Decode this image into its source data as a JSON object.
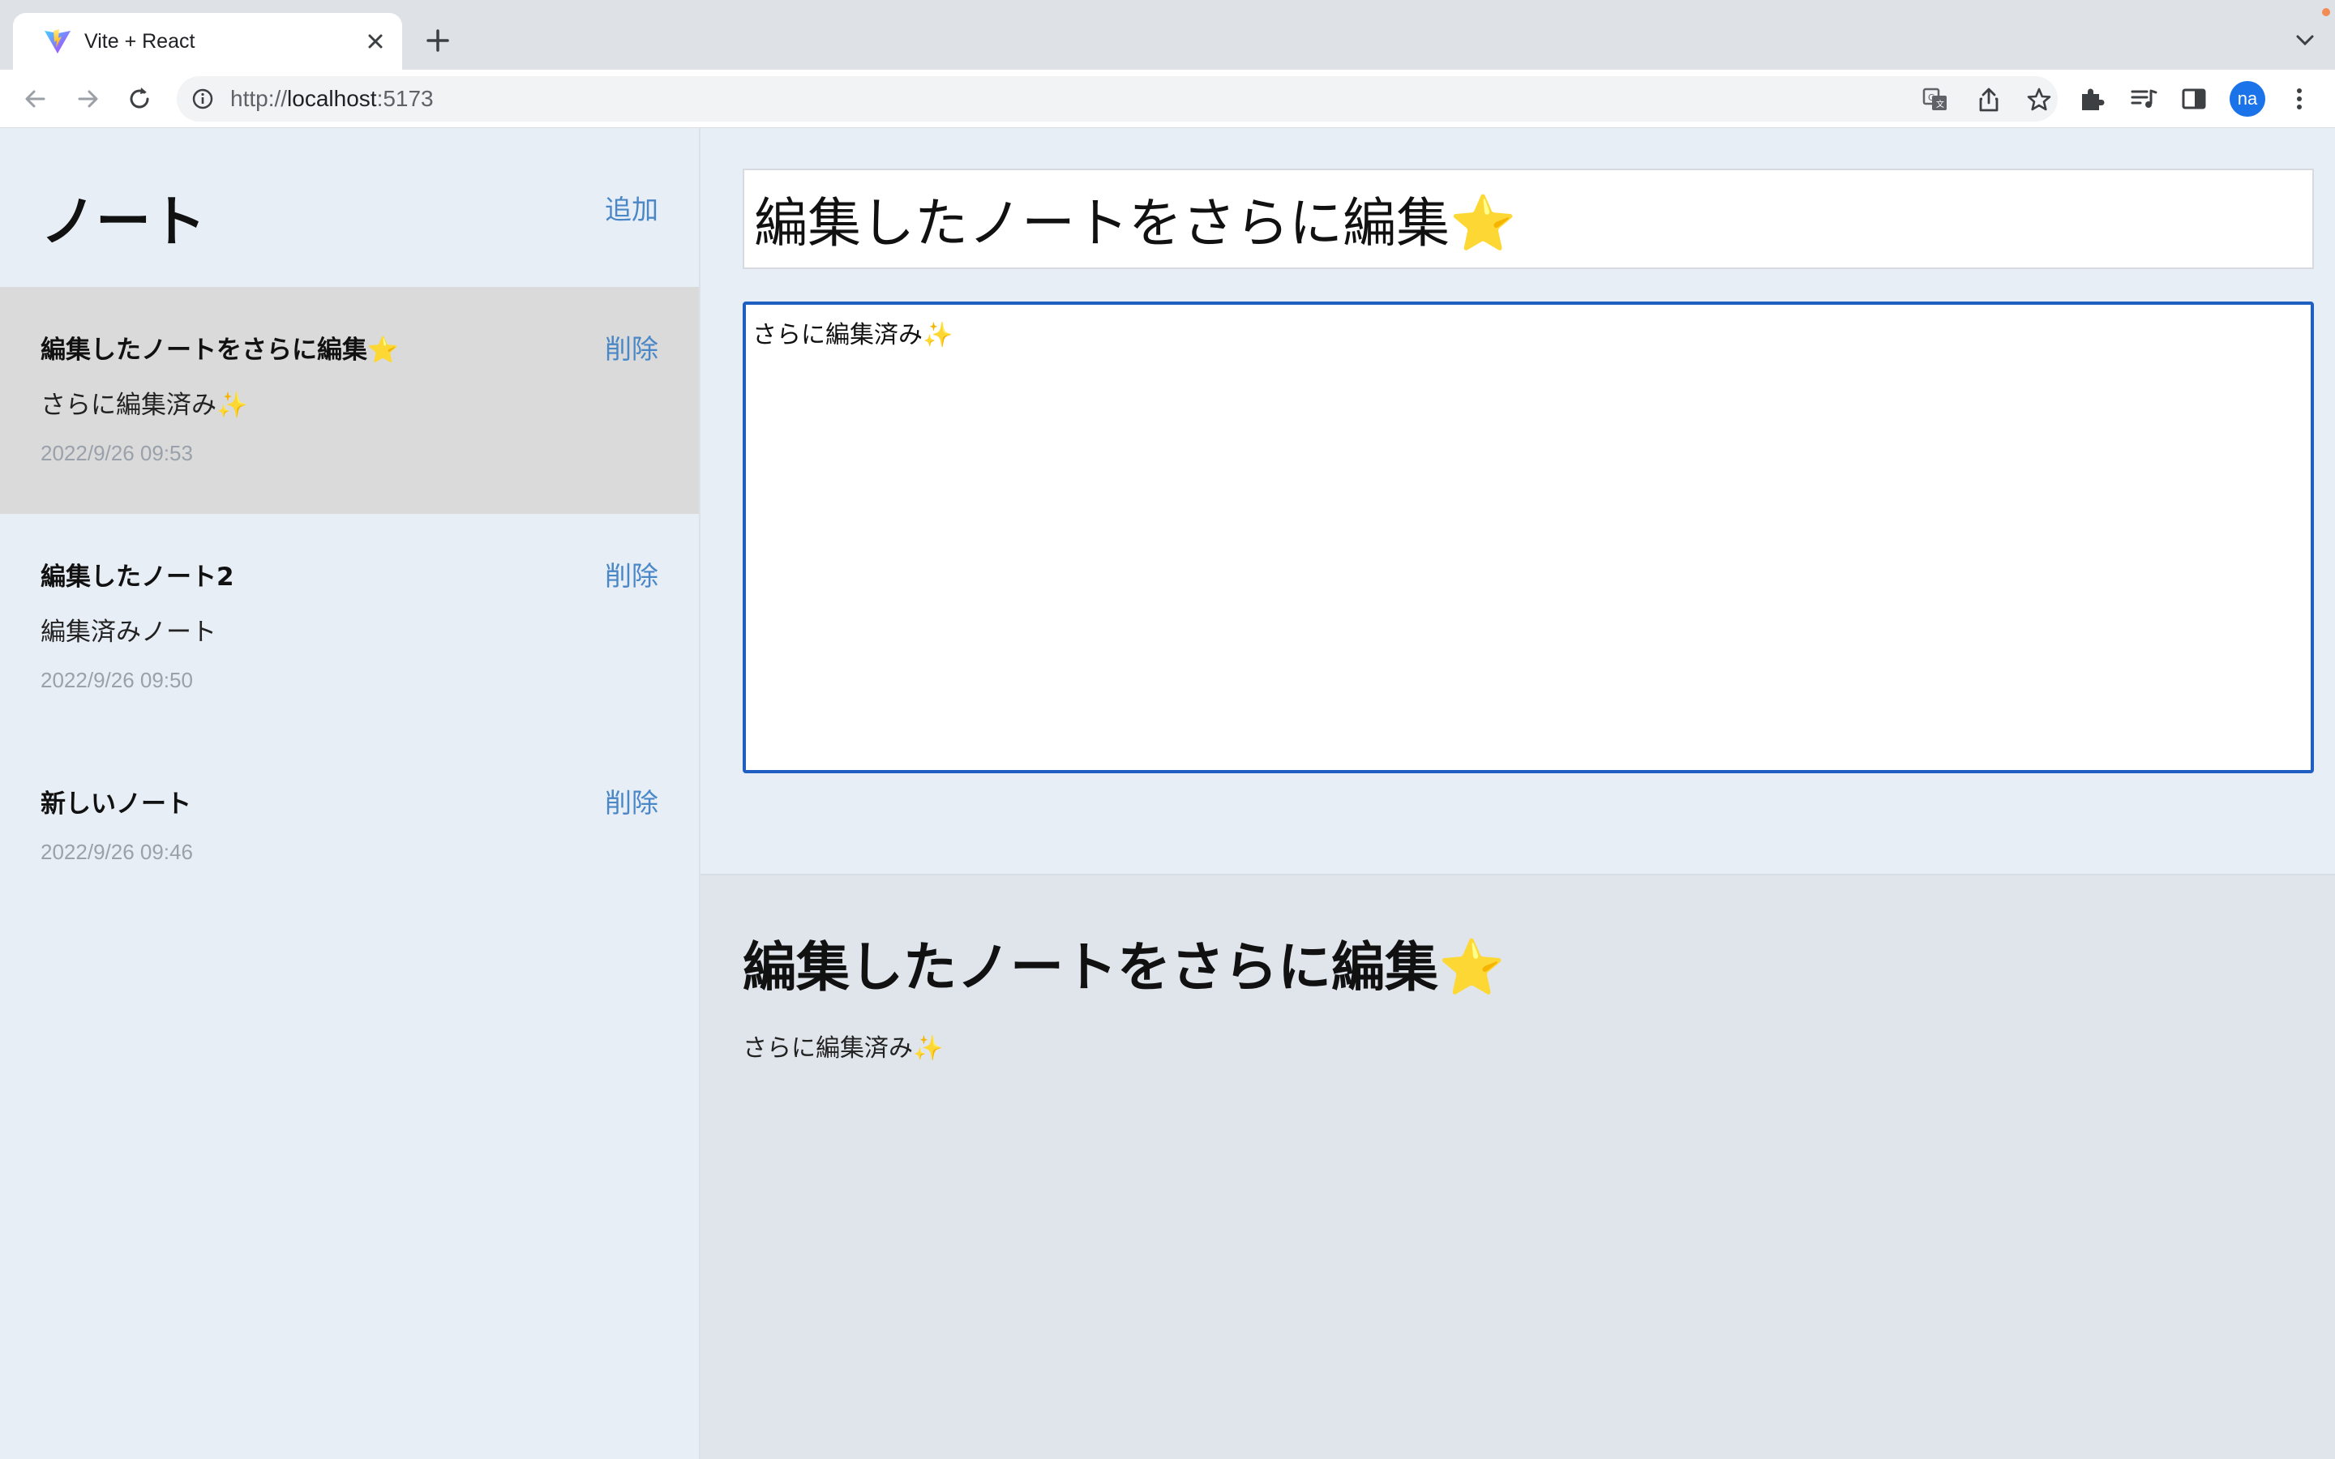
{
  "browser": {
    "tab_title": "Vite + React",
    "url_scheme": "http://",
    "url_host": "localhost",
    "url_port": ":5173",
    "profile_initials": "na"
  },
  "sidebar": {
    "title": "ノート",
    "add_label": "追加",
    "notes": [
      {
        "title": "編集したノートをさらに編集⭐",
        "body": "さらに編集済み✨",
        "date": "2022/9/26 09:53",
        "delete_label": "削除",
        "active": true
      },
      {
        "title": "編集したノート2",
        "body": "編集済みノート",
        "date": "2022/9/26 09:50",
        "delete_label": "削除",
        "active": false
      },
      {
        "title": "新しいノート",
        "body": "",
        "date": "2022/9/26 09:46",
        "delete_label": "削除",
        "active": false
      }
    ]
  },
  "editor": {
    "title_value": "編集したノートをさらに編集⭐",
    "body_value": "さらに編集済み✨"
  },
  "preview": {
    "title": "編集したノートをさらに編集⭐",
    "body": "さらに編集済み✨"
  },
  "colors": {
    "accent_link": "#4a87c6",
    "focus_border": "#1f5fc2",
    "sidebar_bg": "#e8eef6",
    "active_note_bg": "#dadada"
  }
}
